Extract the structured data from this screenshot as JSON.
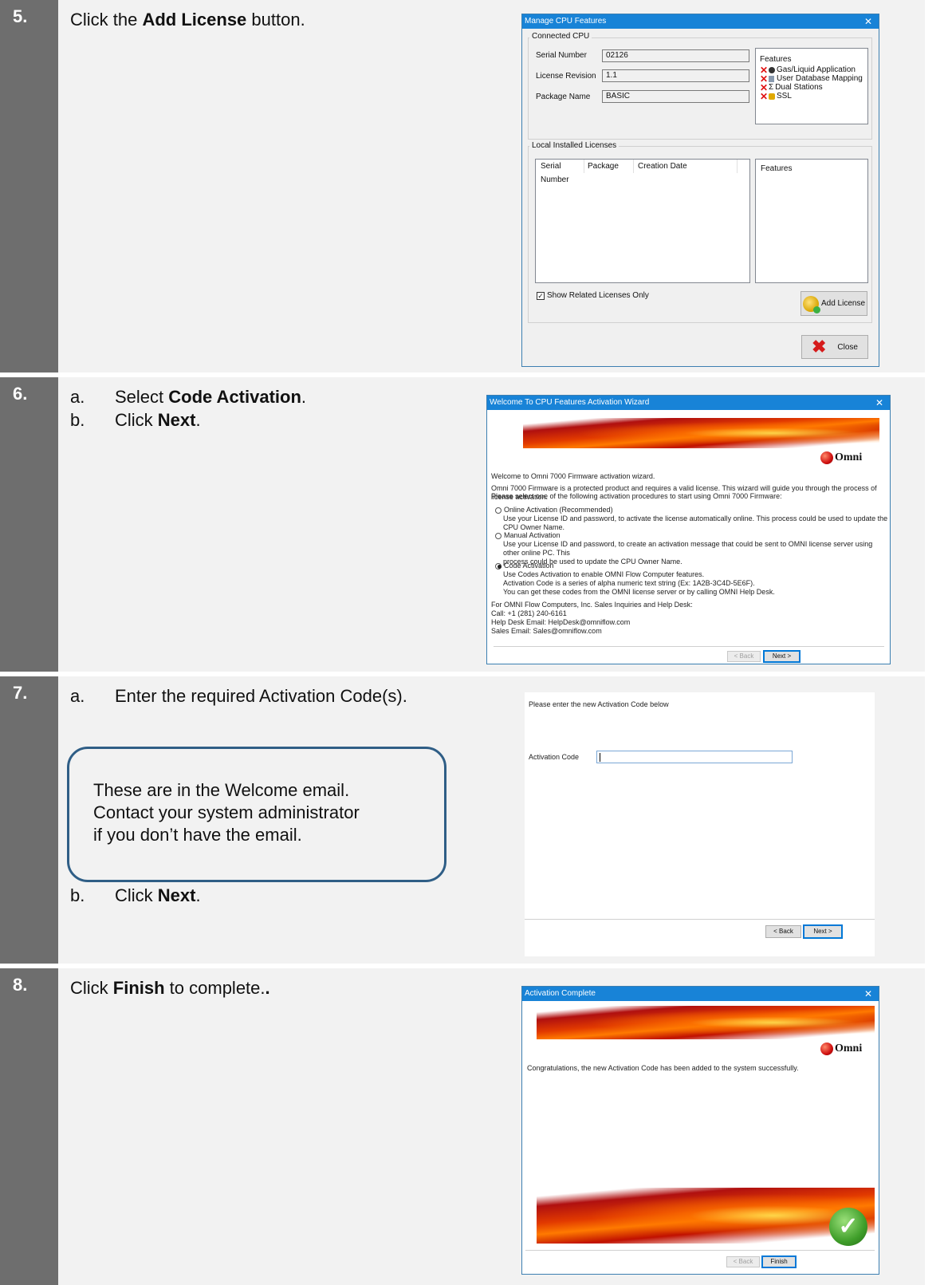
{
  "steps": [
    {
      "number": "5.",
      "lines": [
        {
          "prefix": "",
          "before": "Click the ",
          "bold": "Add License",
          "after": " button."
        }
      ]
    },
    {
      "number": "6.",
      "lines": [
        {
          "prefix": "a.",
          "before": "Select ",
          "bold": "Code Activation",
          "after": "."
        },
        {
          "prefix": "b.",
          "before": "Click ",
          "bold": "Next",
          "after": "."
        }
      ]
    },
    {
      "number": "7.",
      "lines": [
        {
          "prefix": "a.",
          "before": "Enter the required Activation Code(s).",
          "bold": "",
          "after": ""
        },
        {
          "prefix": "b.",
          "before": "Click ",
          "bold": "Next",
          "after": "."
        }
      ],
      "callout": [
        "These are in the Welcome email.",
        "Contact your system administrator",
        "if you don’t have the email."
      ]
    },
    {
      "number": "8.",
      "lines": [
        {
          "prefix": "",
          "before": "Click ",
          "bold": "Finish",
          "after": " to complete."
        }
      ],
      "trailing_bold": "."
    }
  ],
  "manage_dialog": {
    "title": "Manage CPU Features",
    "close_glyph": "✕",
    "connected_group": "Connected CPU",
    "serial_label": "Serial Number",
    "serial_value": "02126",
    "revision_label": "License Revision",
    "revision_value": "1.1",
    "package_label": "Package Name",
    "package_value": "BASIC",
    "features_label": "Features",
    "features": [
      {
        "icon": "gas-liquid-icon",
        "label": "Gas/Liquid Application"
      },
      {
        "icon": "database-icon",
        "label": "User Database Mapping"
      },
      {
        "icon": "sigma-icon",
        "label": "Dual Stations"
      },
      {
        "icon": "lock-icon",
        "label": "SSL"
      }
    ],
    "local_group": "Local Installed Licenses",
    "columns": [
      "Serial Number",
      "Package",
      "Creation Date"
    ],
    "features_col": "Features",
    "show_related": "Show Related Licenses Only",
    "show_related_checked": true,
    "add_license": "Add License",
    "close_button": "Close"
  },
  "welcome_dialog": {
    "title": "Welcome To CPU Features Activation Wizard",
    "logo_text": "Omni",
    "intro": "Welcome to Omni 7000 Firmware activation wizard.",
    "desc1": "Omni 7000 Firmware is a protected product and requires a valid license. This wizard will guide you through the process of license activation.",
    "desc2": "Please select one of the following activation procedures to start using Omni 7000 Firmware:",
    "options": [
      {
        "label": "Online Activation (Recommended)",
        "desc": [
          "Use your License ID and password, to activate the license automatically online. This process could be used to update the CPU Owner Name."
        ],
        "selected": false
      },
      {
        "label": "Manual Activation",
        "desc": [
          "Use your License ID and password, to create an activation message that could be sent to OMNI license server using other online PC.  This",
          "process could be used to update the CPU Owner Name."
        ],
        "selected": false
      },
      {
        "label": "Code Activation",
        "desc": [
          "Use Codes Activation to enable OMNI Flow Computer features.",
          "Activation Code is a series of alpha numeric text string (Ex: 1A2B-3C4D-5E6F).",
          "You can get these codes from the OMNI license server or by calling OMNI Help Desk."
        ],
        "selected": true
      }
    ],
    "contact": [
      "For OMNI Flow Computers, Inc. Sales Inquiries and Help Desk:",
      "Call: +1 (281) 240-6161",
      "Help Desk Email: HelpDesk@omniflow.com",
      "Sales Email: Sales@omniflow.com"
    ],
    "back": "< Back",
    "next": "Next >"
  },
  "code_dialog": {
    "prompt": "Please enter the new Activation Code below",
    "field_label": "Activation Code",
    "field_value": "",
    "back": "< Back",
    "next": "Next >"
  },
  "complete_dialog": {
    "title": "Activation Complete",
    "logo_text": "Omni",
    "message": "Congratulations, the new Activation Code has been added to the system successfully.",
    "back": "< Back",
    "finish": "Finish"
  }
}
